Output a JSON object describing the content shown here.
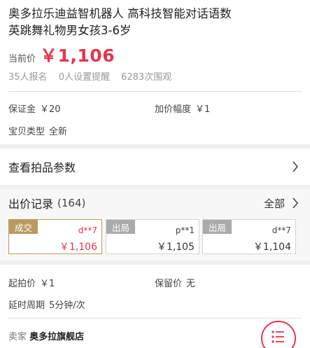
{
  "product": {
    "title": "奥多拉乐迪益智机器人 高科技智能对话语数英跳舞礼物男女孩3-6岁",
    "price_label": "当前价",
    "price": "￥1,106",
    "stats": [
      "35人报名",
      "0人设置提醒",
      "6283次围观"
    ]
  },
  "terms": {
    "deposit_label": "保证金",
    "deposit": "￥20",
    "increment_label": "加价幅度",
    "increment": "￥1",
    "condition_label": "宝贝类型",
    "condition": "全新"
  },
  "params_row": {
    "label": "查看拍品参数"
  },
  "bids": {
    "label": "出价记录",
    "count": "(164)",
    "all_label": "全部",
    "cards": [
      {
        "tag": "成交",
        "bidder": "d**7",
        "amount": "￥1,106"
      },
      {
        "tag": "出局",
        "bidder": "p**1",
        "amount": "￥1,105"
      },
      {
        "tag": "出局",
        "bidder": "d**7",
        "amount": "￥1,104"
      }
    ]
  },
  "auction": {
    "start_label": "起拍价",
    "start": "￥1",
    "reserve_label": "保留价",
    "reserve": "无",
    "extension_label": "延时周期",
    "extension": "5分钟/次"
  },
  "seller": {
    "label": "卖家",
    "name": "奥多拉旗舰店"
  },
  "colors": {
    "accent": "#e8344e",
    "winner_tag": "#b99b5f",
    "out_tag": "#aaaaaa",
    "band": "#efefef"
  },
  "icons": {
    "row_arrow": "chevron-right-icon",
    "menu": "menu-list-icon"
  }
}
